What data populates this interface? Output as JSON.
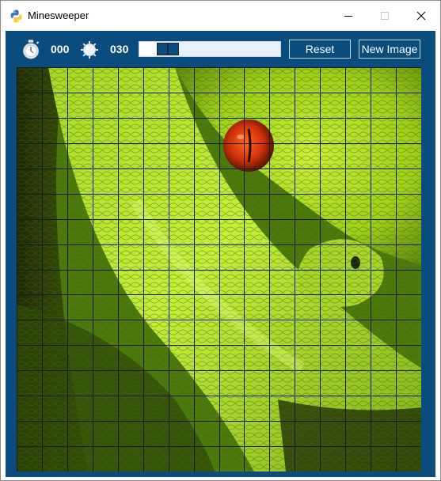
{
  "window": {
    "title": "Minesweeper",
    "controls": [
      "minimize",
      "maximize",
      "close"
    ]
  },
  "toolbar": {
    "timer_icon": "stopwatch-icon",
    "timer_value": "000",
    "mine_icon": "mine-icon",
    "mine_count": "030",
    "progress_fraction": 0.12,
    "reset_label": "Reset",
    "new_image_label": "New Image"
  },
  "board": {
    "rows": 16,
    "cols": 16,
    "image_subject": "green-snake",
    "accent_color": "#0a4c7e",
    "grid_color": "#1a1a1a"
  }
}
